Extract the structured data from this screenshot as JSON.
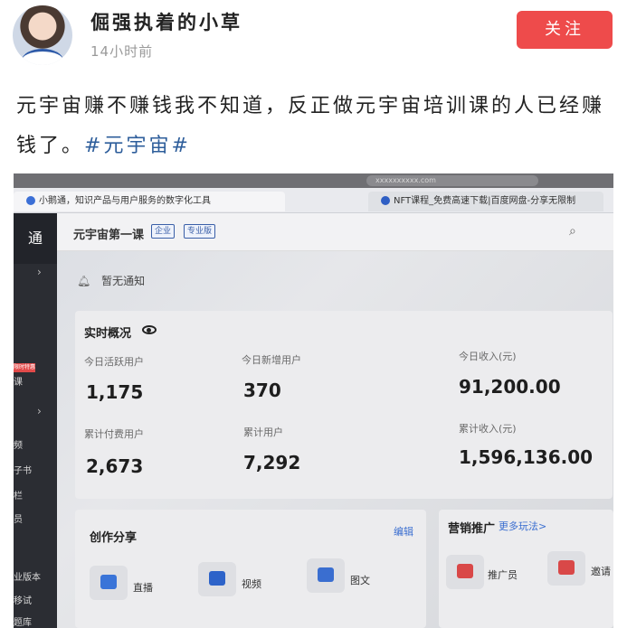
{
  "post": {
    "username": "倔强执着的小草",
    "time": "14小时前",
    "follow_label": "关注",
    "text": "元宇宙赚不赚钱我不知道，反正做元宇宙培训课的人已经赚钱了。",
    "hashtag": "#元宇宙#"
  },
  "screen": {
    "url": "xxxxxxxxxx.com",
    "tabs": [
      "小鹅通，知识产品与用户服务的数字化工具",
      "NFT课程_免费高速下载|百度网盘-分享无限制"
    ],
    "sidebar": {
      "logo": "通",
      "items": [
        "课",
        "频",
        "子书",
        "栏",
        "员",
        "业版本",
        "移试",
        "题库"
      ],
      "badge": "限时特惠"
    },
    "header": {
      "title": "元宇宙第一课",
      "tags": [
        "企业",
        "专业版"
      ]
    },
    "notice": "暂无通知",
    "overview": {
      "title": "实时概况",
      "stats": [
        {
          "label": "今日活跃用户",
          "value": "1,175"
        },
        {
          "label": "今日新增用户",
          "value": "370"
        },
        {
          "label": "今日收入(元)",
          "value": "91,200.00"
        },
        {
          "label": "累计付费用户",
          "value": "2,673"
        },
        {
          "label": "累计用户",
          "value": "7,292"
        },
        {
          "label": "累计收入(元)",
          "value": "1,596,136.00"
        }
      ]
    },
    "share": {
      "title": "创作分享",
      "edit": "编辑",
      "items": [
        {
          "label": "直播",
          "icon": "live-tv-icon"
        },
        {
          "label": "视频",
          "icon": "video-camera-icon"
        },
        {
          "label": "图文",
          "icon": "article-icon"
        }
      ]
    },
    "marketing": {
      "title": "营销推广",
      "more": "更多玩法>",
      "items": [
        {
          "label": "推广员",
          "icon": "megaphone-icon"
        },
        {
          "label": "邀请",
          "icon": "invite-icon"
        }
      ]
    }
  },
  "colors": {
    "follow": "#ee4b4b",
    "hashtag": "#2e5e9b",
    "link": "#3a6ed0",
    "live_icon": "#3a74d8",
    "marketing_icon": "#d94848"
  }
}
